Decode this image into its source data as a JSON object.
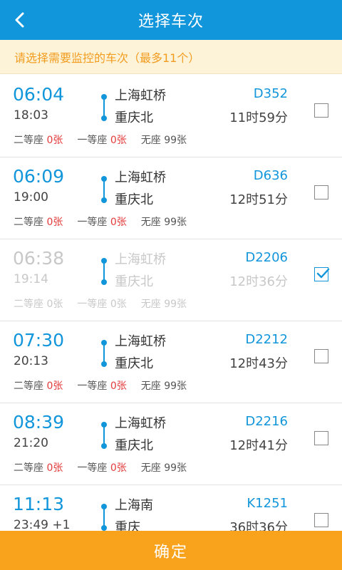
{
  "header": {
    "title": "选择车次",
    "back_icon": "back-chevron-icon"
  },
  "notice": "请选择需要监控的车次（最多11个）",
  "trains": [
    {
      "dep": "06:04",
      "arr": "18:03",
      "from": "上海虹桥",
      "to": "重庆北",
      "train": "D352",
      "duration": "11时59分",
      "seats": [
        {
          "type": "二等座",
          "count": "0张",
          "red": true
        },
        {
          "type": "一等座",
          "count": "0张",
          "red": true
        },
        {
          "type": "无座",
          "count": "99张",
          "red": false
        }
      ],
      "checked": false,
      "disabled": false
    },
    {
      "dep": "06:09",
      "arr": "19:00",
      "from": "上海虹桥",
      "to": "重庆北",
      "train": "D636",
      "duration": "12时51分",
      "seats": [
        {
          "type": "二等座",
          "count": "0张",
          "red": true
        },
        {
          "type": "一等座",
          "count": "0张",
          "red": true
        },
        {
          "type": "无座",
          "count": "99张",
          "red": false
        }
      ],
      "checked": false,
      "disabled": false
    },
    {
      "dep": "06:38",
      "arr": "19:14",
      "from": "上海虹桥",
      "to": "重庆北",
      "train": "D2206",
      "duration": "12时36分",
      "seats": [
        {
          "type": "二等座",
          "count": "0张",
          "red": false
        },
        {
          "type": "一等座",
          "count": "0张",
          "red": false
        },
        {
          "type": "无座",
          "count": "99张",
          "red": false
        }
      ],
      "checked": true,
      "disabled": true
    },
    {
      "dep": "07:30",
      "arr": "20:13",
      "from": "上海虹桥",
      "to": "重庆北",
      "train": "D2212",
      "duration": "12时43分",
      "seats": [
        {
          "type": "二等座",
          "count": "0张",
          "red": true
        },
        {
          "type": "一等座",
          "count": "0张",
          "red": true
        },
        {
          "type": "无座",
          "count": "99张",
          "red": false
        }
      ],
      "checked": false,
      "disabled": false
    },
    {
      "dep": "08:39",
      "arr": "21:20",
      "from": "上海虹桥",
      "to": "重庆北",
      "train": "D2216",
      "duration": "12时41分",
      "seats": [
        {
          "type": "二等座",
          "count": "0张",
          "red": true
        },
        {
          "type": "一等座",
          "count": "0张",
          "red": true
        },
        {
          "type": "无座",
          "count": "99张",
          "red": false
        }
      ],
      "checked": false,
      "disabled": false
    },
    {
      "dep": "11:13",
      "arr": "23:49 +1",
      "from": "上海南",
      "to": "重庆",
      "train": "K1251",
      "duration": "36时36分",
      "seats": [],
      "checked": false,
      "disabled": false
    }
  ],
  "confirm_label": "确定",
  "colors": {
    "primary": "#1296db",
    "accent": "#f9a21b",
    "notice_bg": "#fdf3d8",
    "notice_text": "#f29c1f",
    "sold_out": "#e33a3a"
  }
}
